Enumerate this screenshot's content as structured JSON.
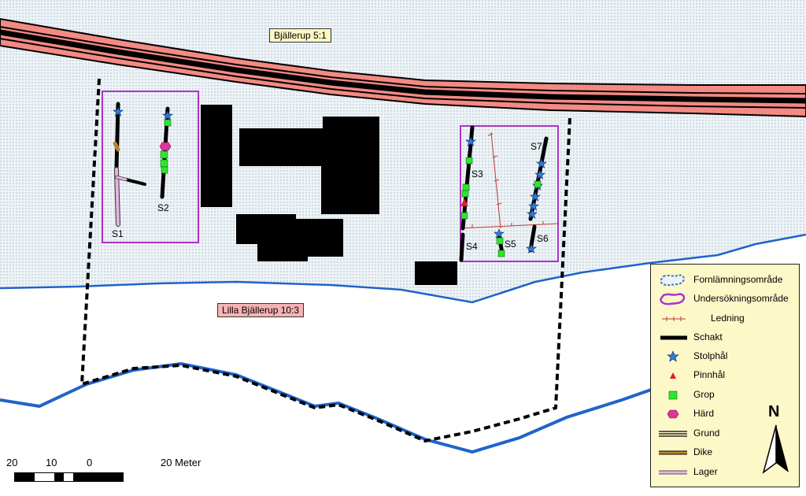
{
  "map": {
    "labels": {
      "property_north": "Bjällerup 5:1",
      "property_south": "Lilla Bjällerup 10:3"
    },
    "trenches": [
      "S1",
      "S2",
      "S3",
      "S4",
      "S5",
      "S6",
      "S7"
    ],
    "colors": {
      "ancient_area_fill": "#eef3f6",
      "ancient_area_dots": "#9fb7c9",
      "investigation_area": "#b030c8",
      "boundary_line": "#1f64c8",
      "road_fill": "#f38a83",
      "road_edge": "#000000",
      "building": "#000000",
      "posthole": "#2e7ad6",
      "stakehole": "#e02020",
      "pit": "#2ee62e",
      "hearth": "#e0359b",
      "ditch": "#b8862d",
      "layer": "#e8b6e0",
      "conduit": "#c0392b"
    }
  },
  "legend": {
    "items": [
      {
        "label": "Fornlämningsområde",
        "symbol": "area-outline-icon"
      },
      {
        "label": "Undersökningsområde",
        "symbol": "investigation-outline-icon"
      },
      {
        "label": "Ledning",
        "symbol": "conduit-line-icon"
      },
      {
        "label": "Schakt",
        "symbol": "trench-line-icon"
      },
      {
        "label": "Stolphål",
        "symbol": "star-icon"
      },
      {
        "label": "Pinnhål",
        "symbol": "triangle-icon"
      },
      {
        "label": "Grop",
        "symbol": "square-icon"
      },
      {
        "label": "Härd",
        "symbol": "hexagon-icon"
      },
      {
        "label": "Grund",
        "symbol": "foundation-line-icon"
      },
      {
        "label": "Dike",
        "symbol": "ditch-line-icon"
      },
      {
        "label": "Lager",
        "symbol": "layer-line-icon"
      }
    ]
  },
  "north_arrow": {
    "letter": "N"
  },
  "scale_bar": {
    "ticks": [
      "20",
      "10",
      "0",
      "20 Meter"
    ]
  }
}
